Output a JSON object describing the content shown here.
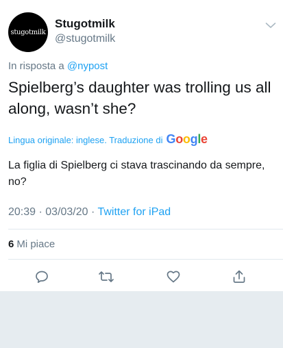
{
  "tweet": {
    "avatar_text": "stugotmilk",
    "display_name": "Stugotmilk",
    "handle": "@stugotmilk",
    "reply_prefix": "In risposta a ",
    "reply_mention": "@nypost",
    "text": "Spielberg’s daughter was trolling us all along, wasn’t she?",
    "original_language_label": "Lingua originale: inglese. Traduzione di",
    "google_logo_text": "Google",
    "translation": "La figlia di Spielberg ci stava trascinando da sempre, no?",
    "time": "20:39",
    "separator": " · ",
    "date": "03/03/20",
    "source": "Twitter for iPad",
    "likes_count": "6",
    "likes_label": "Mi piace"
  },
  "icons": {
    "menu": "chevron-down-icon",
    "reply": "reply-icon",
    "retweet": "retweet-icon",
    "like": "like-icon",
    "share": "share-icon"
  },
  "colors": {
    "link_blue": "#1da1f2",
    "secondary_gray": "#657786",
    "text_dark": "#14171a",
    "divider": "#e1e8ed",
    "page_background": "#e6ecf0",
    "google": [
      "#4285f4",
      "#ea4335",
      "#fbbc05",
      "#4285f4",
      "#34a853",
      "#ea4335"
    ]
  }
}
